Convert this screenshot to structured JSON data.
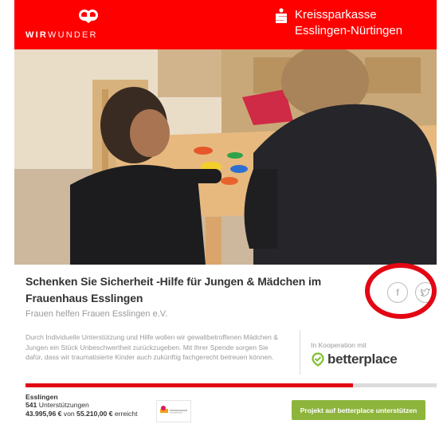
{
  "header": {
    "brand_left_bold": "WIR",
    "brand_left_light": "WUNDER",
    "sparkasse_name": "Kreissparkasse",
    "sparkasse_region": "Esslingen-Nürtingen",
    "colors": {
      "header_bg": "#ff0000",
      "accent": "#e30613",
      "cta": "#8db53c"
    }
  },
  "project": {
    "title": "Schenken Sie Sicherheit -Hilfe für Jungen & Mädchen im Frauenhaus Esslingen",
    "organization": "Frauen helfen Frauen Esslingen e.V.",
    "description": "Durch Individuelle Unterstützung und Hilfe wollen wir gewaltbetroffenen Mädchen & Jungen ein Stück Unbeschwertheit zurückzugeben. Mit Ihrer Spende sorgen Sie dafür, dass wir traumatisierte Kinder auch zukünftig fachgerecht betreuen können.",
    "cooperation_label": "In Kooperation mit",
    "partner_name": "betterplace",
    "city": "Esslingen",
    "supporters_count": "541",
    "supporters_label": "Unterstützungen",
    "amount_raised": "43.995,96 €",
    "amount_connector": "von",
    "amount_goal": "55.210,00 €",
    "amount_suffix": "erreicht",
    "progress_fraction": 0.797,
    "cta_label": "Projekt auf betterplace unterstützen"
  },
  "share": {
    "facebook_icon": "facebook-icon",
    "twitter_icon": "twitter-icon"
  }
}
